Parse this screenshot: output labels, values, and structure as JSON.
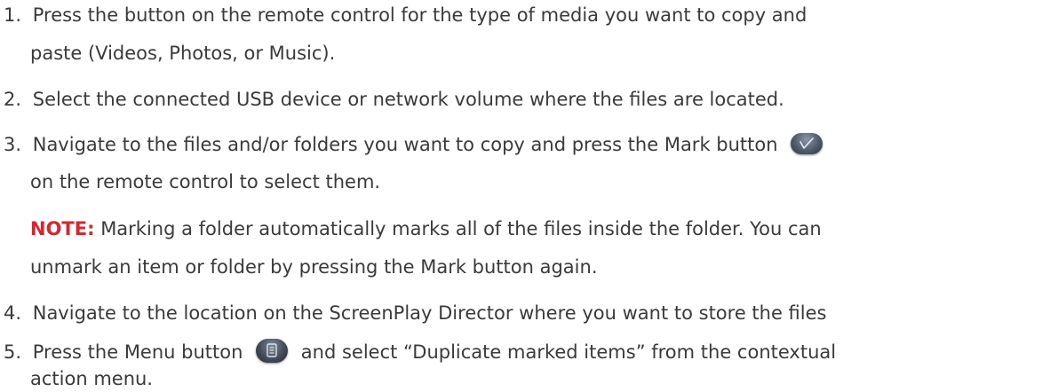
{
  "steps": [
    {
      "number": "1.",
      "line1": "Press the button on the remote control for the type of media you want to copy and",
      "line2": "paste (Videos, Photos, or Music)."
    },
    {
      "number": "2.",
      "line1": "Select the connected USB device or network volume where the files are located."
    },
    {
      "number": "3.",
      "line1": "Navigate to the files and/or folders you want to copy and press the Mark button",
      "line2": "on the remote control to select them."
    },
    {
      "number": "4.",
      "line1": "Navigate to the location on the ScreenPlay Director where you want to store the files"
    },
    {
      "number": "5.",
      "line1_before": "Press the Menu button",
      "line1_after": "and select “Duplicate marked items” from the contextual",
      "line2": "action menu."
    }
  ],
  "note": {
    "label": "NOTE:",
    "line1": "Marking a folder automatically marks all of the files inside the folder. You can",
    "line2": "unmark an item or folder by pressing the Mark button again."
  },
  "icons": {
    "mark_button": "mark-button-icon",
    "menu_button": "menu-button-icon"
  },
  "colors": {
    "text": "#3a3a3a",
    "note_label": "#d8262e"
  }
}
